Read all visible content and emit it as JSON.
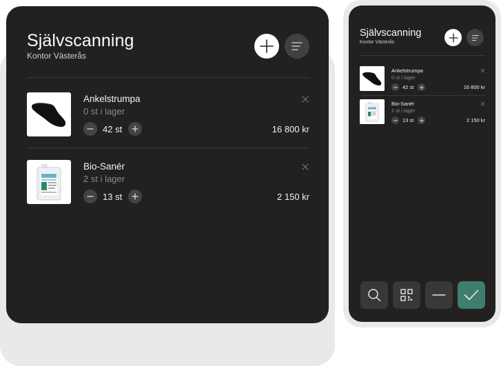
{
  "app": {
    "title": "Självscanning",
    "subtitle": "Kontor Västerås"
  },
  "header": {
    "icons": {
      "add": "plus-icon",
      "menu": "filter-lines-icon"
    }
  },
  "items": [
    {
      "name": "Ankelstrumpa",
      "stock": "0 st i lager",
      "quantity": "42 st",
      "price": "16 800 kr",
      "thumbnail": "sock-icon"
    },
    {
      "name": "Bio-Sanér",
      "stock": "2 st i lager",
      "quantity": "13 st",
      "price": "2 150 kr",
      "thumbnail": "bottle-icon"
    }
  ],
  "toolbar": {
    "buttons": [
      "search-icon",
      "qr-code-icon",
      "minus-icon",
      "check-icon"
    ]
  },
  "colors": {
    "screen_bg": "#232120",
    "frame": "#e9e9e9",
    "button_bg": "#434140",
    "confirm": "#3f7d6f",
    "muted_text": "#8d8b89"
  }
}
